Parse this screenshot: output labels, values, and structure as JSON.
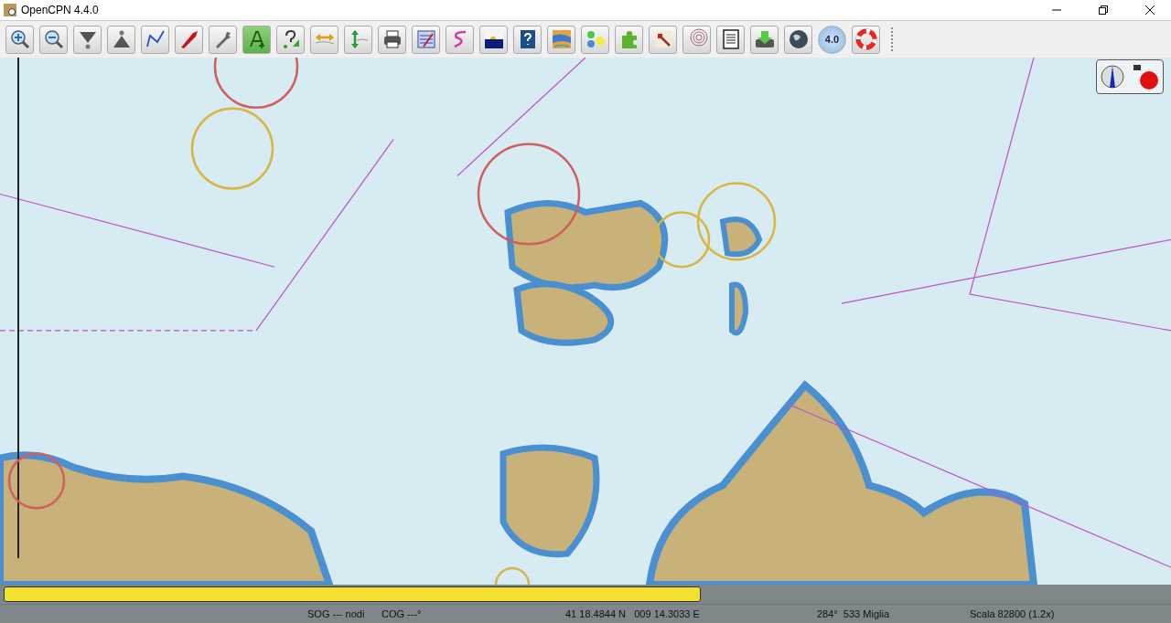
{
  "window": {
    "title": "OpenCPN 4.4.0"
  },
  "toolbar": [
    {
      "kind": "zoom-in"
    },
    {
      "kind": "zoom-out"
    },
    {
      "kind": "scale-in"
    },
    {
      "kind": "scale-out"
    },
    {
      "kind": "route"
    },
    {
      "kind": "boat"
    },
    {
      "kind": "wrench"
    },
    {
      "kind": "text"
    },
    {
      "kind": "query"
    },
    {
      "kind": "h-arrows"
    },
    {
      "kind": "v-arrows"
    },
    {
      "kind": "printer"
    },
    {
      "kind": "list"
    },
    {
      "kind": "track"
    },
    {
      "kind": "sunset"
    },
    {
      "kind": "help"
    },
    {
      "kind": "weather"
    },
    {
      "kind": "gauges"
    },
    {
      "kind": "puzzle"
    },
    {
      "kind": "chart-pencil"
    },
    {
      "kind": "contours"
    },
    {
      "kind": "document"
    },
    {
      "kind": "download"
    },
    {
      "kind": "globe"
    },
    {
      "kind": "dial",
      "label": "4.0"
    },
    {
      "kind": "lifebuoy"
    }
  ],
  "chart_bar": {
    "keys": [
      {
        "selected": true
      }
    ]
  },
  "status_bar": [
    "SOG --- nodi",
    "COG ---°",
    "41 18.4844 N   009 14.3033 E",
    "284°  533 Miglia",
    "Scala 82800 (1.2x)"
  ]
}
